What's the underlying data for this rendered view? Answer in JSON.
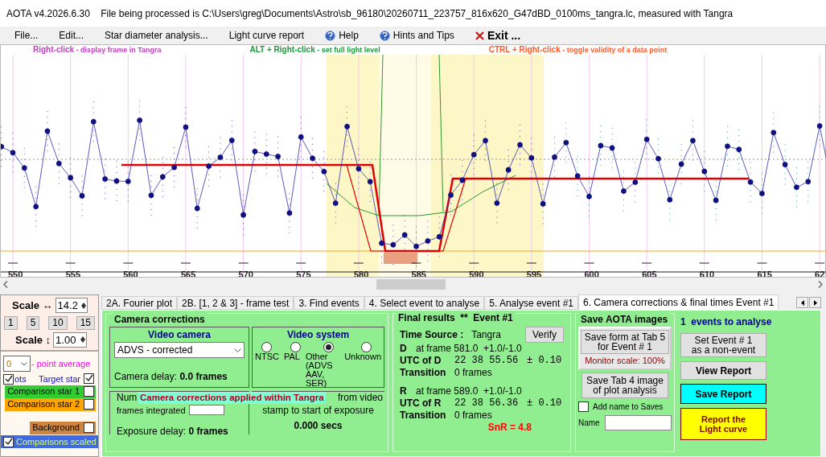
{
  "window": {
    "title": "AOTA v4.2026.6.30    File being processed is C:\\Users\\greg\\Documents\\Astro\\sb_96180\\20260711_223757_816x620_G47dBD_0100ms_tangra.lc, measured with Tangra"
  },
  "menu": [
    {
      "label": "File...",
      "kind": "plain"
    },
    {
      "label": "Edit...",
      "kind": "plain"
    },
    {
      "label": "Star diameter analysis...",
      "kind": "plain"
    },
    {
      "label": "Light curve report",
      "kind": "plain"
    },
    {
      "label": "Help",
      "kind": "help"
    },
    {
      "label": "Hints and Tips",
      "kind": "help"
    },
    {
      "label": "Exit ...",
      "kind": "exit"
    }
  ],
  "hints": [
    {
      "key": "Right-click",
      "text": " - display frame in Tangra",
      "color": "#c040c0"
    },
    {
      "key": "ALT + Right-click",
      "text": " - set full light level",
      "color": "#1a9a3a"
    },
    {
      "key": "CTRL + Right-click",
      "text": " - toggle validity of a data point",
      "color": "#ff5a2a"
    }
  ],
  "plot": {
    "x_labels": [
      "550",
      "555",
      "560",
      "565",
      "570",
      "575",
      "580",
      "585",
      "590",
      "595",
      "600",
      "605",
      "610",
      "615",
      "62"
    ]
  },
  "scale_panel": {
    "horizontal": {
      "label": "Scale ↔",
      "value": "14.2"
    },
    "presets": [
      "1",
      "5",
      "10",
      "15"
    ],
    "vertical": {
      "label": "Scale ↕",
      "value": "1.00"
    }
  },
  "series_panel": {
    "average": {
      "value": "0",
      "label": "- point average"
    },
    "points": {
      "label": "ots",
      "checked": true
    },
    "target": {
      "label": "Target star",
      "checked": true
    },
    "rows": [
      {
        "label": "Comparison star 1",
        "checked": false,
        "color": "#32cd32"
      },
      {
        "label": "Comparison star 2",
        "checked": false,
        "color": "#ffa500"
      },
      {
        "label": "Background",
        "checked": false,
        "color": "#cd853f"
      }
    ],
    "scaled": {
      "label": "Comparisons scaled",
      "checked": true
    }
  },
  "tabs": [
    {
      "label": "2A. Fourier plot",
      "selected": false
    },
    {
      "label": "2B. [1, 2 & 3] - frame test",
      "selected": false
    },
    {
      "label": "3. Find events",
      "selected": false
    },
    {
      "label": "4. Select event to analyse",
      "selected": false
    },
    {
      "label": "5. Analyse event #1",
      "selected": false
    },
    {
      "label": "6. Camera corrections & final times Event #1",
      "selected": true
    }
  ],
  "camera_corrections": {
    "title": "Camera corrections",
    "video_camera": {
      "title": "Video camera",
      "value": "ADVS - corrected",
      "delay_label": "Camera delay: ",
      "delay_value": "0.0 frames"
    },
    "video_system": {
      "title": "Video system",
      "options": [
        {
          "label": "NTSC",
          "selected": false
        },
        {
          "label": "PAL",
          "selected": false
        },
        {
          "label": "Other\n(ADVS\nAAV, SER)",
          "selected": true
        },
        {
          "label": "Unknown",
          "selected": false
        }
      ]
    },
    "frames": {
      "label_top": "Num",
      "label_bottom": "frames integrated",
      "exposure_label": "Exposure delay: ",
      "exposure_value": "0 frames"
    },
    "offset": {
      "label_top": "from video",
      "label_bottom": "stamp to start of exposure",
      "value": "0.000 secs"
    },
    "notice": "Camera corrections applied within Tangra"
  },
  "final_results": {
    "title": "Final results  **  Event #1",
    "time_source_label": "Time Source :",
    "time_source": "Tangra",
    "verify": "Verify",
    "events": [
      {
        "name": "D",
        "frame": "at frame 581.0  +1.0/-1.0",
        "utc_label": "UTC of D",
        "utc": "22 38 55.56",
        "uncertainty": "± 0.10",
        "transition_label": "Transition",
        "transition": "0 frames"
      },
      {
        "name": "R",
        "frame": "at frame 589.0  +1.0/-1.0",
        "utc_label": "UTC of R",
        "utc": "22 38 56.36",
        "uncertainty": "± 0.10",
        "transition_label": "Transition",
        "transition": "0 frames"
      }
    ],
    "snr": "SnR = 4.8"
  },
  "save_images": {
    "title": "Save AOTA images",
    "save_form": "Save form at Tab 5\nfor Event # 1",
    "monitor_scale": "Monitor scale: 100%",
    "save_tab4": "Save Tab 4 image\nof plot analysis",
    "add_name": {
      "label": "Add name to Saves",
      "checked": false
    },
    "name_label": "Name"
  },
  "events_panel": {
    "count": "1  events to analyse",
    "non_event": "Set Event # 1\nas a non-event",
    "view_report": "View Report",
    "save_report": "Save Report",
    "report_curve": "Report the\nLight curve"
  }
}
